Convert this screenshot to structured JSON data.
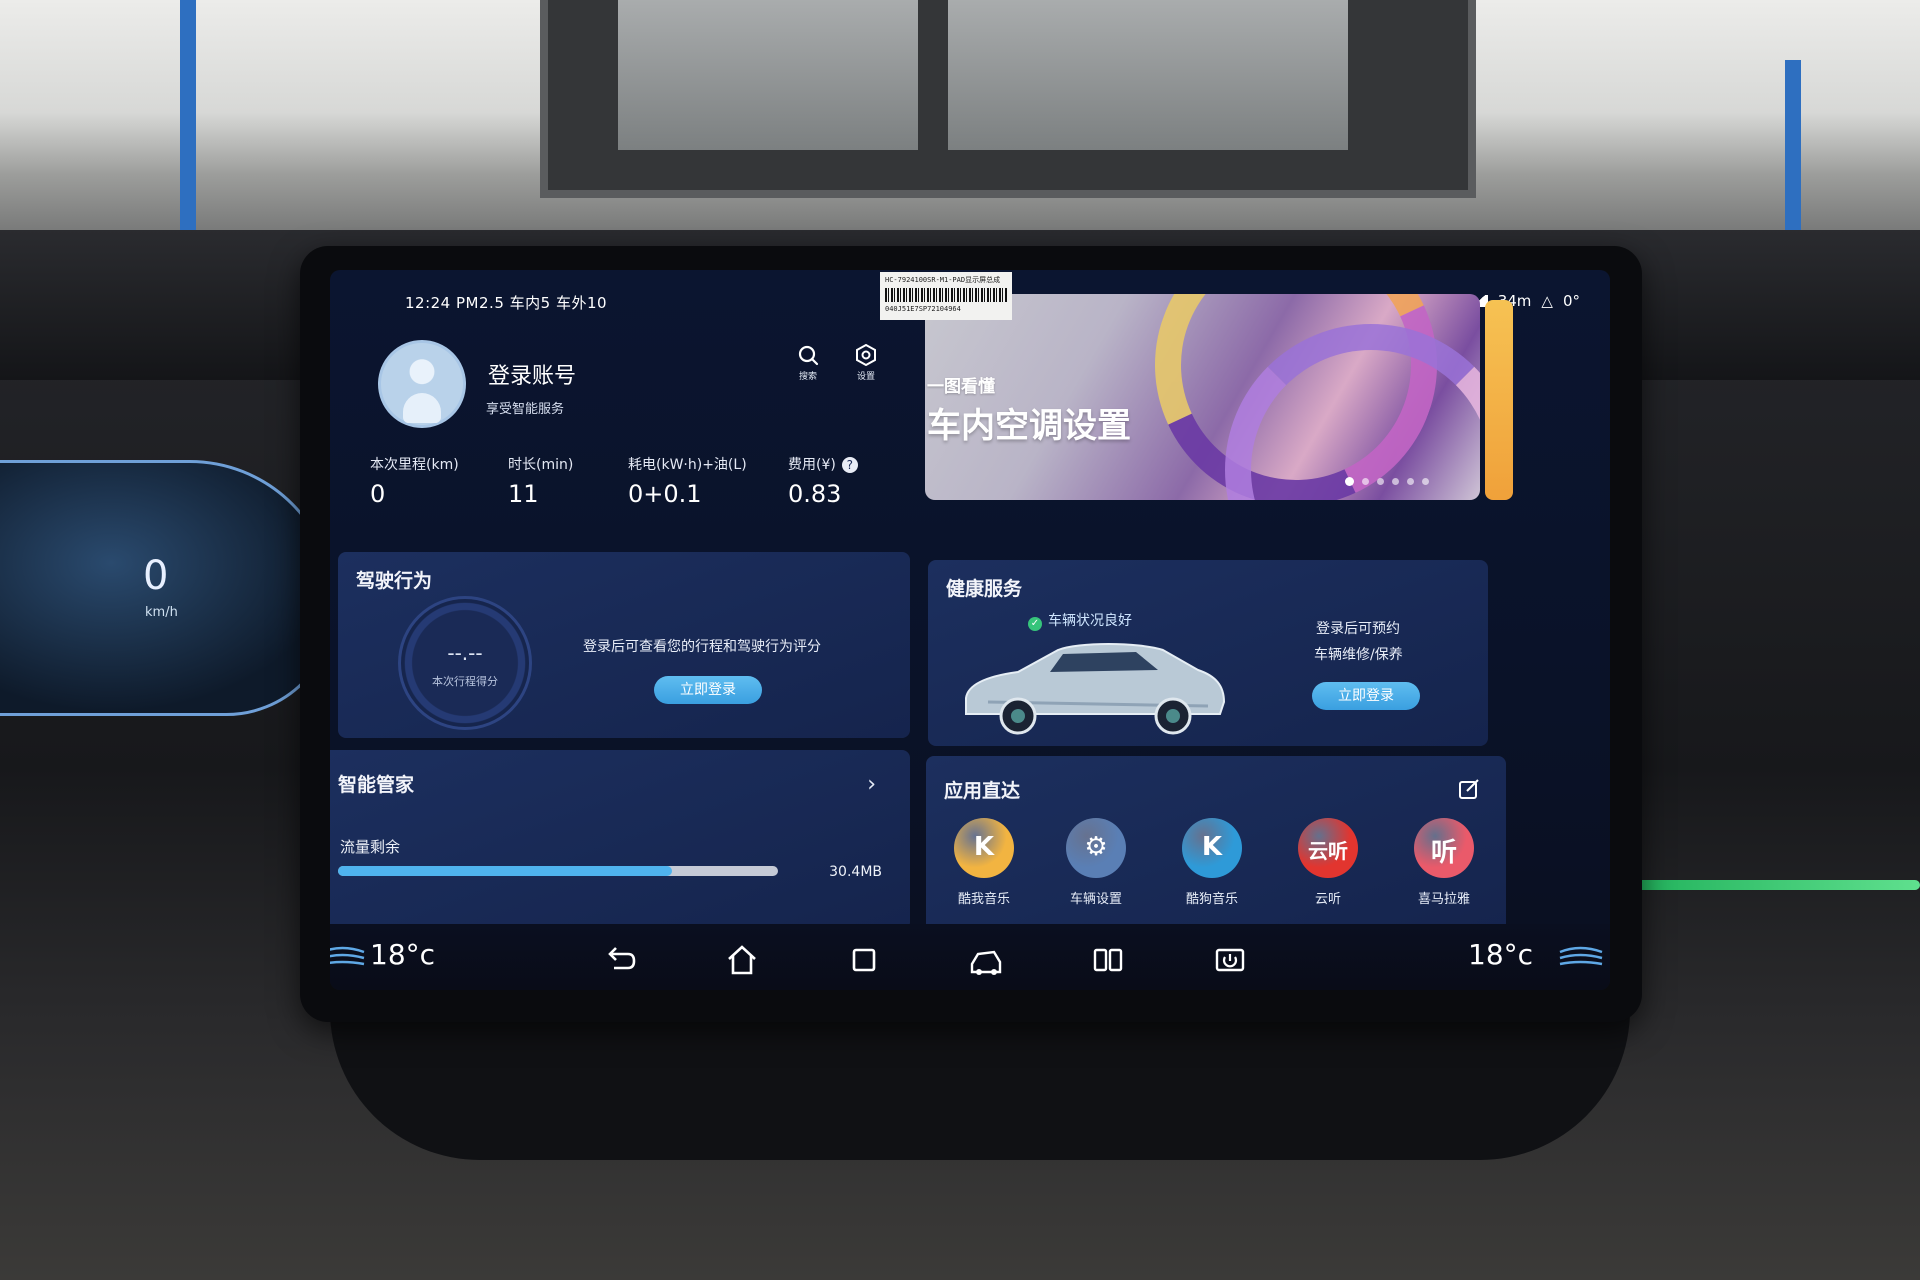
{
  "status_bar": {
    "time": "12:24",
    "air": "PM2.5 车内5 车外10",
    "right_text": "34m",
    "right_extra": "0°"
  },
  "account": {
    "name": "登录账号",
    "subtitle": "享受智能服务",
    "search_label": "搜索",
    "settings_label": "设置",
    "stats": [
      {
        "label": "本次里程(km)",
        "value": "0"
      },
      {
        "label": "时长(min)",
        "value": "11"
      },
      {
        "label": "耗电(kW·h)+油(L)",
        "value": "0+0.1"
      },
      {
        "label": "费用(¥)",
        "value": "0.83"
      }
    ],
    "help_glyph": "?"
  },
  "banner": {
    "small_title": "一图看懂",
    "title": "车内空调设置",
    "active_slide": 1,
    "slide_count": 6
  },
  "driving": {
    "title": "驾驶行为",
    "score_value": "--.--",
    "score_label": "本次行程得分",
    "message": "登录后可查看您的行程和驾驶行为评分",
    "login_button": "立即登录"
  },
  "health": {
    "title": "健康服务",
    "status": "车辆状况良好",
    "line1": "登录后可预约",
    "line2": "车辆维修/保养",
    "login_button": "立即登录"
  },
  "manager": {
    "title": "智能管家",
    "data_label": "流量剩余",
    "data_value": "30.4MB",
    "data_fraction": 0.76
  },
  "apps": {
    "title": "应用直达",
    "items": [
      {
        "name": "酷我音乐",
        "glyph": "K",
        "color": "#f2b441",
        "icon": "kuwo-icon"
      },
      {
        "name": "车辆设置",
        "glyph": "⚙",
        "color": "#5a7fb5",
        "icon": "car-settings-icon"
      },
      {
        "name": "酷狗音乐",
        "glyph": "K",
        "color": "#2e9ad8",
        "icon": "kugou-icon"
      },
      {
        "name": "云听",
        "glyph": "云听",
        "color": "#e2352f",
        "icon": "yunting-icon"
      },
      {
        "name": "喜马拉雅",
        "glyph": "听",
        "color": "#ea5a6a",
        "icon": "ximalaya-icon"
      }
    ]
  },
  "dock": {
    "left_temp": "18°c",
    "right_temp": "18°c"
  },
  "sticker": {
    "line1": "HC-7924100SR-M1-PAD显示屏总成",
    "line2": "040J51E7SP72104964"
  },
  "cluster": {
    "speed": "0",
    "unit": "km/h"
  }
}
